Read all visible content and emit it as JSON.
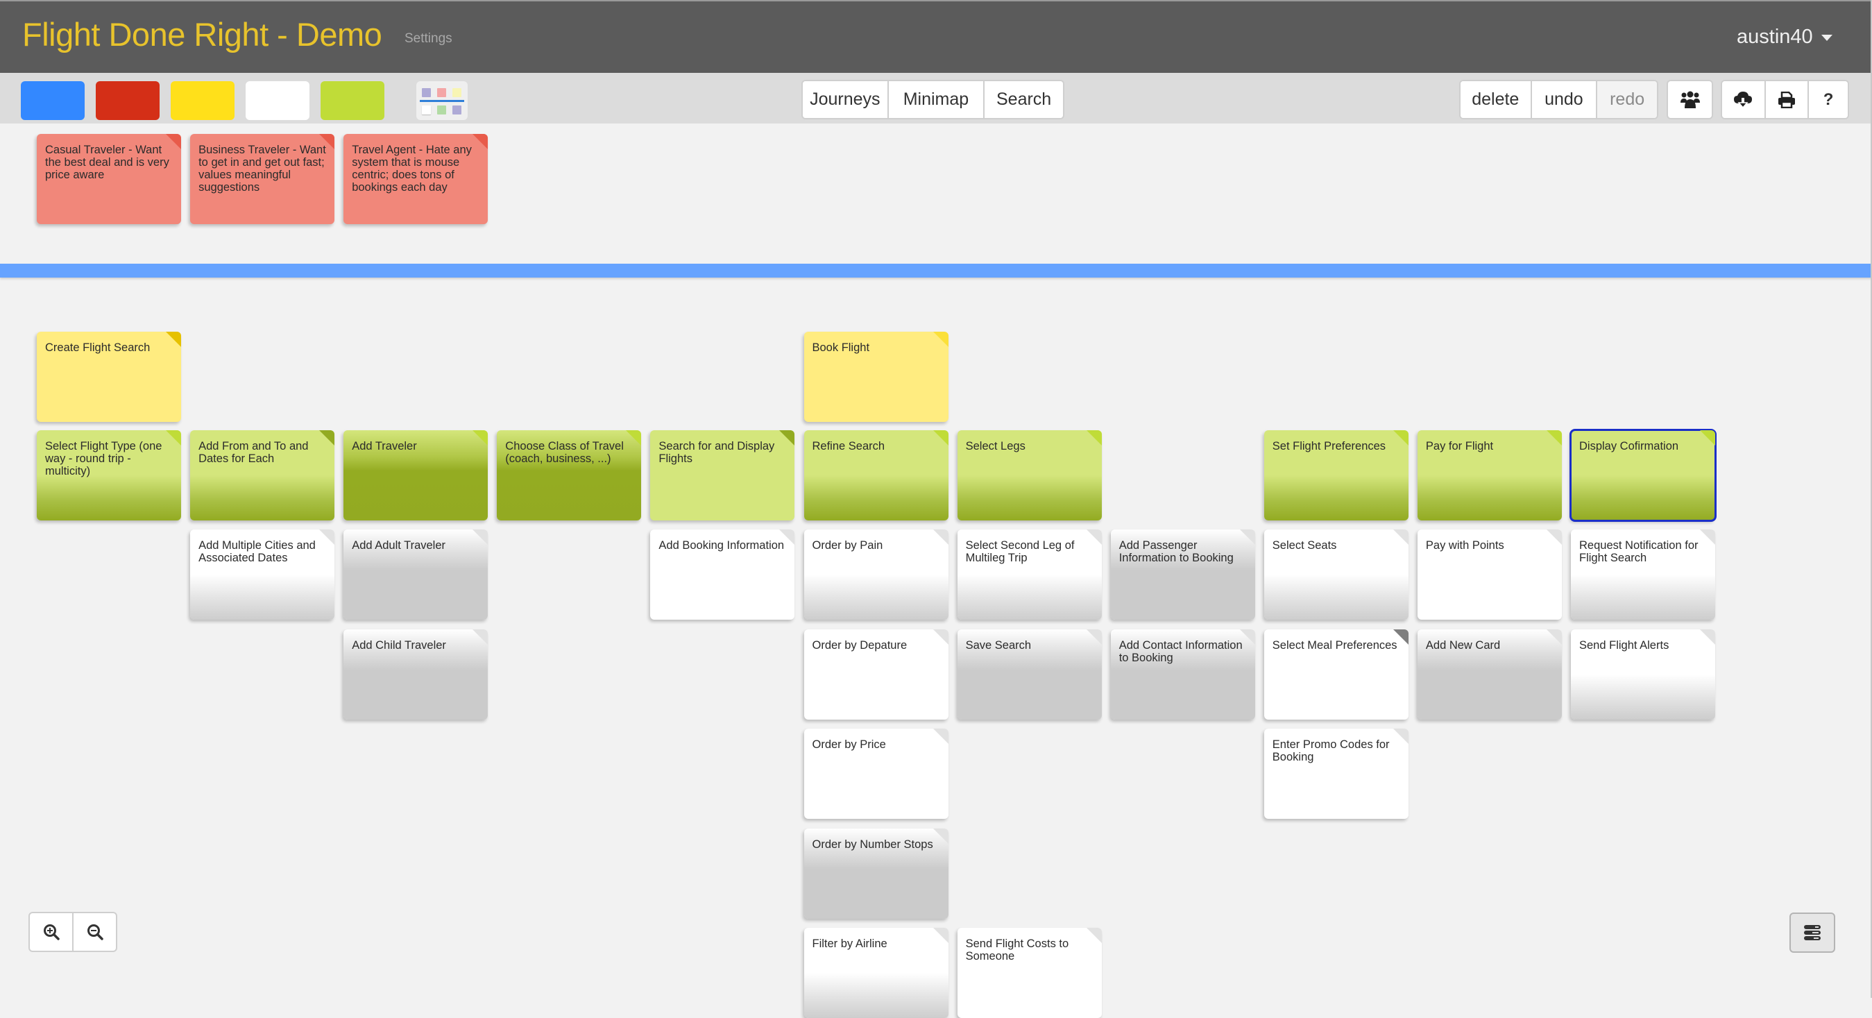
{
  "header": {
    "title": "Flight Done Right - Demo",
    "settings_label": "Settings",
    "username": "austin40"
  },
  "toolbar": {
    "color_swatches": [
      {
        "name": "blue",
        "color": "#3388ff"
      },
      {
        "name": "red",
        "color": "#d42f17"
      },
      {
        "name": "yellow",
        "color": "#ffe01a"
      },
      {
        "name": "white",
        "color": "#ffffff"
      },
      {
        "name": "green",
        "color": "#c0dc38"
      }
    ],
    "template_icon": "card-layout-template-icon",
    "view_buttons": [
      "Journeys",
      "Minimap",
      "Search"
    ],
    "edit_buttons": {
      "delete": "delete",
      "undo": "undo",
      "redo": "redo"
    },
    "icons": {
      "team": "users-icon",
      "export": "cloud-download-icon",
      "print": "print-icon",
      "help": "?"
    }
  },
  "personas": [
    {
      "text": "Casual Traveler - Want the best deal and is very price aware"
    },
    {
      "text": "Business Traveler - Want to get in and get out fast; values meaningful suggestions"
    },
    {
      "text": "Travel Agent -  Hate any system that is mouse centric; does tons of bookings each day"
    }
  ],
  "activities": [
    {
      "col": 0,
      "text": "Create Flight Search"
    },
    {
      "col": 5,
      "text": "Book Flight"
    }
  ],
  "tasks": [
    {
      "col": 0,
      "text": "Select Flight Type (one way - round trip - multicity)",
      "status": "in-progress"
    },
    {
      "col": 1,
      "text": "Add From and To and Dates for Each",
      "status": "in-progress"
    },
    {
      "col": 2,
      "text": "Add Traveler",
      "status": "done"
    },
    {
      "col": 3,
      "text": "Choose Class of Travel (coach, business, ...)",
      "status": "done"
    },
    {
      "col": 4,
      "text": "Search for and Display Flights",
      "status": "not-started"
    },
    {
      "col": 5,
      "text": "Refine Search",
      "status": "in-progress"
    },
    {
      "col": 6,
      "text": "Select Legs",
      "status": "in-progress"
    },
    {
      "col": 8,
      "text": "Set Flight Preferences",
      "status": "in-progress"
    },
    {
      "col": 9,
      "text": "Pay for Flight",
      "status": "in-progress"
    },
    {
      "col": 10,
      "text": "Display Cofirmation",
      "status": "in-progress",
      "selected": true
    }
  ],
  "stories": [
    {
      "col": 1,
      "row": 0,
      "text": "Add Multiple Cities and Associated Dates",
      "status": "in-progress"
    },
    {
      "col": 2,
      "row": 0,
      "text": "Add Adult Traveler",
      "status": "done"
    },
    {
      "col": 2,
      "row": 1,
      "text": "Add Child Traveler",
      "status": "done"
    },
    {
      "col": 4,
      "row": 0,
      "text": "Add Booking Information",
      "status": "not-started"
    },
    {
      "col": 5,
      "row": 0,
      "text": "Order by Pain",
      "status": "in-progress"
    },
    {
      "col": 5,
      "row": 1,
      "text": "Order by Depature",
      "status": "not-started"
    },
    {
      "col": 5,
      "row": 2,
      "text": "Order by Price",
      "status": "not-started"
    },
    {
      "col": 5,
      "row": 3,
      "text": "Order by Number Stops",
      "status": "done"
    },
    {
      "col": 5,
      "row": 4,
      "text": "Filter by Airline",
      "status": "in-progress"
    },
    {
      "col": 6,
      "row": 0,
      "text": "Select Second Leg of Multileg Trip",
      "status": "in-progress"
    },
    {
      "col": 6,
      "row": 1,
      "text": "Save Search",
      "status": "done"
    },
    {
      "col": 6,
      "row": 4,
      "text": "Send Flight Costs to Someone",
      "status": "not-started"
    },
    {
      "col": 7,
      "row": 0,
      "text": "Add Passenger Information to Booking",
      "status": "done"
    },
    {
      "col": 7,
      "row": 1,
      "text": "Add Contact Information to Booking",
      "status": "done"
    },
    {
      "col": 8,
      "row": 0,
      "text": "Select Seats",
      "status": "in-progress"
    },
    {
      "col": 8,
      "row": 1,
      "text": "Select Meal Preferences",
      "status": "not-started",
      "flag": "grey-corner"
    },
    {
      "col": 8,
      "row": 2,
      "text": "Enter Promo Codes for Booking",
      "status": "not-started"
    },
    {
      "col": 9,
      "row": 0,
      "text": "Pay with Points",
      "status": "not-started"
    },
    {
      "col": 9,
      "row": 1,
      "text": "Add New Card",
      "status": "done"
    },
    {
      "col": 10,
      "row": 0,
      "text": "Request Notification for Flight Search",
      "status": "in-progress"
    },
    {
      "col": 10,
      "row": 1,
      "text": "Send Flight Alerts",
      "status": "in-progress"
    }
  ],
  "controls": {
    "zoom_in": "zoom-in-icon",
    "zoom_out": "zoom-out-icon",
    "layout_toggle": "server-stack-icon"
  }
}
